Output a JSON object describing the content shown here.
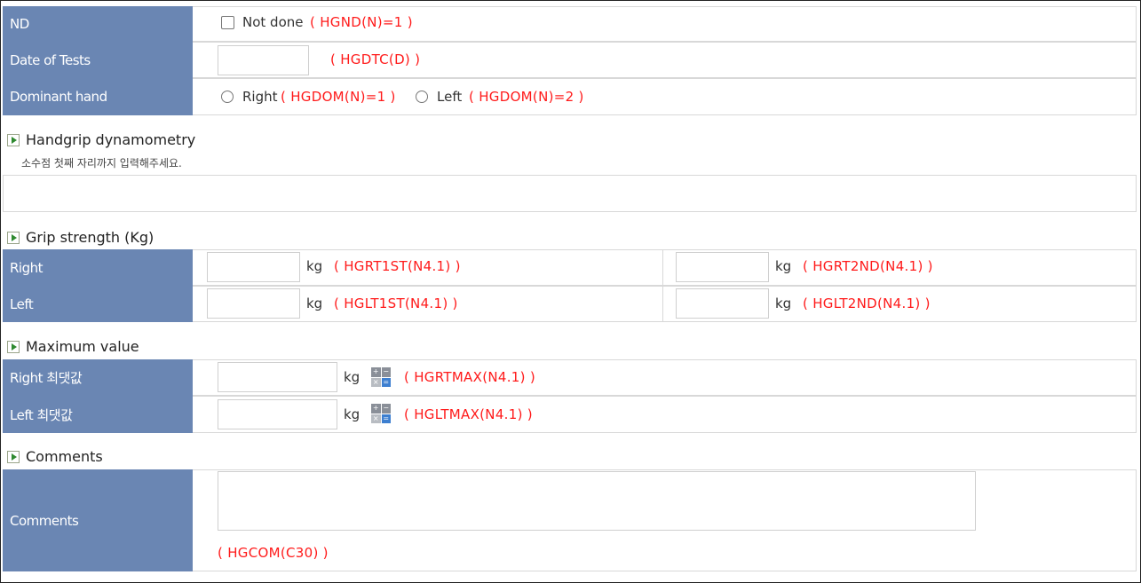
{
  "nd": {
    "label": "ND",
    "checkbox_label": "Not done",
    "code": "( HGND(N)=1 )"
  },
  "date": {
    "label": "Date of Tests",
    "value": "",
    "code": "( HGDTC(D) )"
  },
  "dominant": {
    "label": "Dominant hand",
    "right_label": "Right",
    "right_code": "( HGDOM(N)=1 )",
    "left_label": "Left",
    "left_code": "( HGDOM(N)=2 )"
  },
  "handgrip": {
    "title": "Handgrip dynamometry",
    "note": "소수점 첫째 자리까지 입력해주세요."
  },
  "grip": {
    "title": "Grip strength (Kg)",
    "unit": "kg",
    "rows": [
      {
        "label": "Right",
        "first_value": "",
        "first_code": "( HGRT1ST(N4.1) )",
        "second_value": "",
        "second_code": "( HGRT2ND(N4.1) )"
      },
      {
        "label": "Left",
        "first_value": "",
        "first_code": "( HGLT1ST(N4.1) )",
        "second_value": "",
        "second_code": "( HGLT2ND(N4.1) )"
      }
    ]
  },
  "maximum": {
    "title": "Maximum value",
    "unit": "kg",
    "rows": [
      {
        "label": "Right 최댓값",
        "value": "",
        "code": "( HGRTMAX(N4.1) )"
      },
      {
        "label": "Left 최댓값",
        "value": "",
        "code": "( HGLTMAX(N4.1) )"
      }
    ]
  },
  "comments": {
    "title": "Comments",
    "label": "Comments",
    "value": "",
    "code": "( HGCOM(C30) )"
  },
  "colors": {
    "label_bg": "#6a86b3",
    "code_red": "#ff1a1a",
    "bullet_green": "#2f8a2f"
  }
}
